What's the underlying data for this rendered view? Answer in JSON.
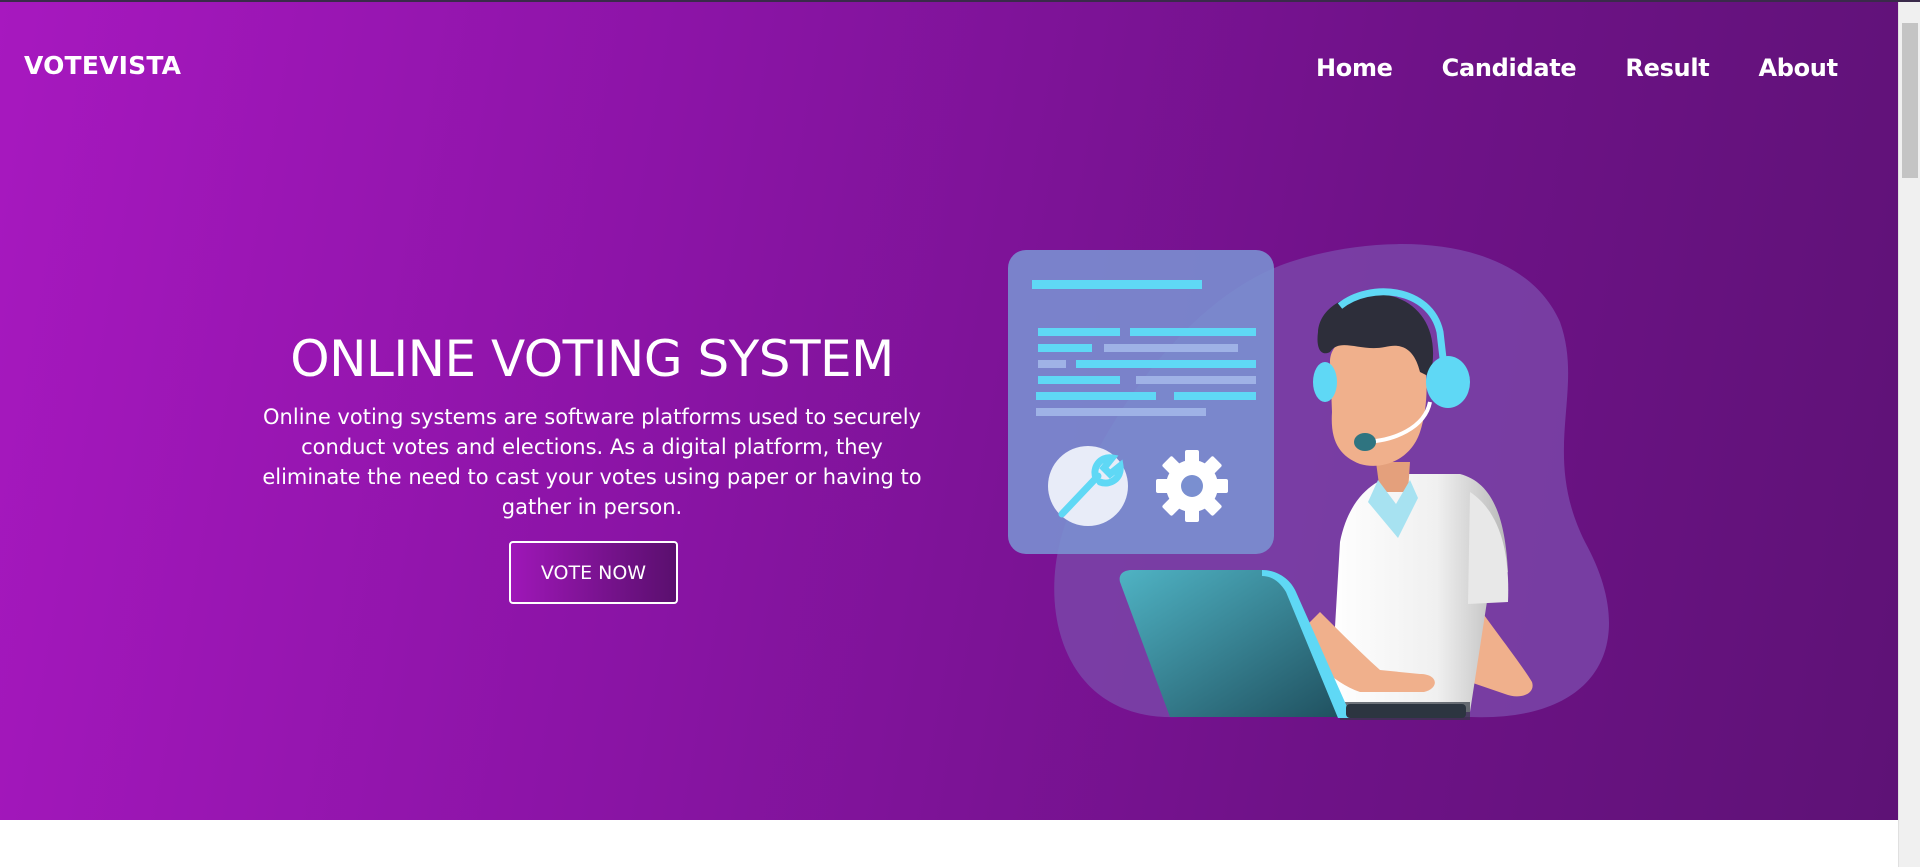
{
  "brand": {
    "name": "VOTEVISTA"
  },
  "nav": {
    "items": [
      "Home",
      "Candidate",
      "Result",
      "About"
    ]
  },
  "hero": {
    "title": "ONLINE VOTING SYSTEM",
    "description": "Online voting systems are software platforms used to securely conduct votes and elections. As a digital platform, they eliminate the need to cast your votes using paper or having to gather in person.",
    "cta_label": "VOTE NOW"
  },
  "illustration": {
    "icons": [
      "wrench-icon",
      "gear-icon",
      "headset-icon",
      "laptop-icon"
    ]
  },
  "colors": {
    "gradient_start": "#a718bf",
    "gradient_end": "#5e1276",
    "accent": "#5fd8f5"
  }
}
